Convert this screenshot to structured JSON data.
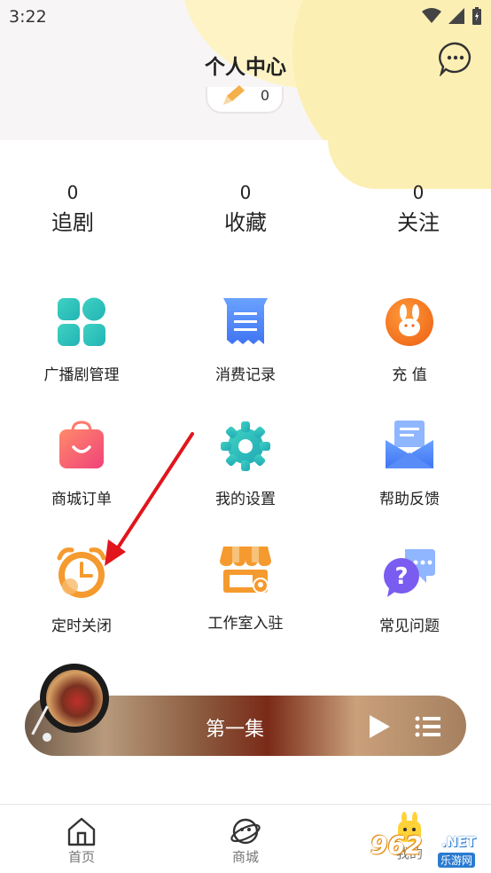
{
  "status_bar": {
    "time": "3:22"
  },
  "header": {
    "title": "个人中心",
    "pencil_count": "0"
  },
  "stats": [
    {
      "value": "0",
      "label": "追剧"
    },
    {
      "value": "0",
      "label": "收藏"
    },
    {
      "value": "0",
      "label": "关注"
    }
  ],
  "grid": [
    {
      "label": "广播剧管理",
      "icon": "apps-grid-icon"
    },
    {
      "label": "消费记录",
      "icon": "receipt-icon"
    },
    {
      "label": "充 值",
      "icon": "rabbit-coin-icon"
    },
    {
      "label": "商城订单",
      "icon": "shopping-bag-icon"
    },
    {
      "label": "我的设置",
      "icon": "gear-icon"
    },
    {
      "label": "帮助反馈",
      "icon": "envelope-icon"
    },
    {
      "label": "定时关闭",
      "icon": "alarm-clock-icon"
    },
    {
      "label": "工作室入驻",
      "icon": "storefront-icon"
    },
    {
      "label": "常见问题",
      "icon": "question-chat-icon"
    }
  ],
  "player": {
    "title": "第一集"
  },
  "tabs": [
    {
      "label": "首页",
      "icon": "home-icon"
    },
    {
      "label": "商城",
      "icon": "planet-icon"
    },
    {
      "label": "我的",
      "icon": "mascot-icon"
    }
  ],
  "watermark": {
    "brand": "962",
    "domain": ".NET",
    "subtitle": "乐游网"
  },
  "colors": {
    "accent_yellow": "#fcefb4",
    "orange": "#f59a2e",
    "teal": "#2bc2b8",
    "annotation_red": "#e0161c"
  }
}
